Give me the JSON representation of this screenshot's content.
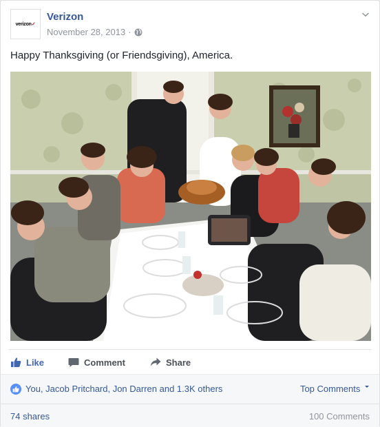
{
  "post": {
    "page_name": "Verizon",
    "avatar_label": "verizon",
    "date": "November 28, 2013",
    "separator": "·",
    "text": "Happy Thanksgiving (or Friendsgiving), America."
  },
  "actions": {
    "like": "Like",
    "comment": "Comment",
    "share": "Share"
  },
  "reactions": {
    "summary": "You, Jacob Pritchard, Jon Darren and 1.3K others",
    "top_comments": "Top Comments"
  },
  "stats": {
    "shares": "74 shares",
    "comments": "100 Comments"
  },
  "colors": {
    "link": "#365899",
    "like_blue": "#4267b2",
    "badge_blue": "#5890ff",
    "brand_red": "#cd040b"
  },
  "icons": [
    "globe-icon",
    "chevron-down-icon",
    "thumbs-up-icon",
    "comment-icon",
    "share-icon"
  ]
}
